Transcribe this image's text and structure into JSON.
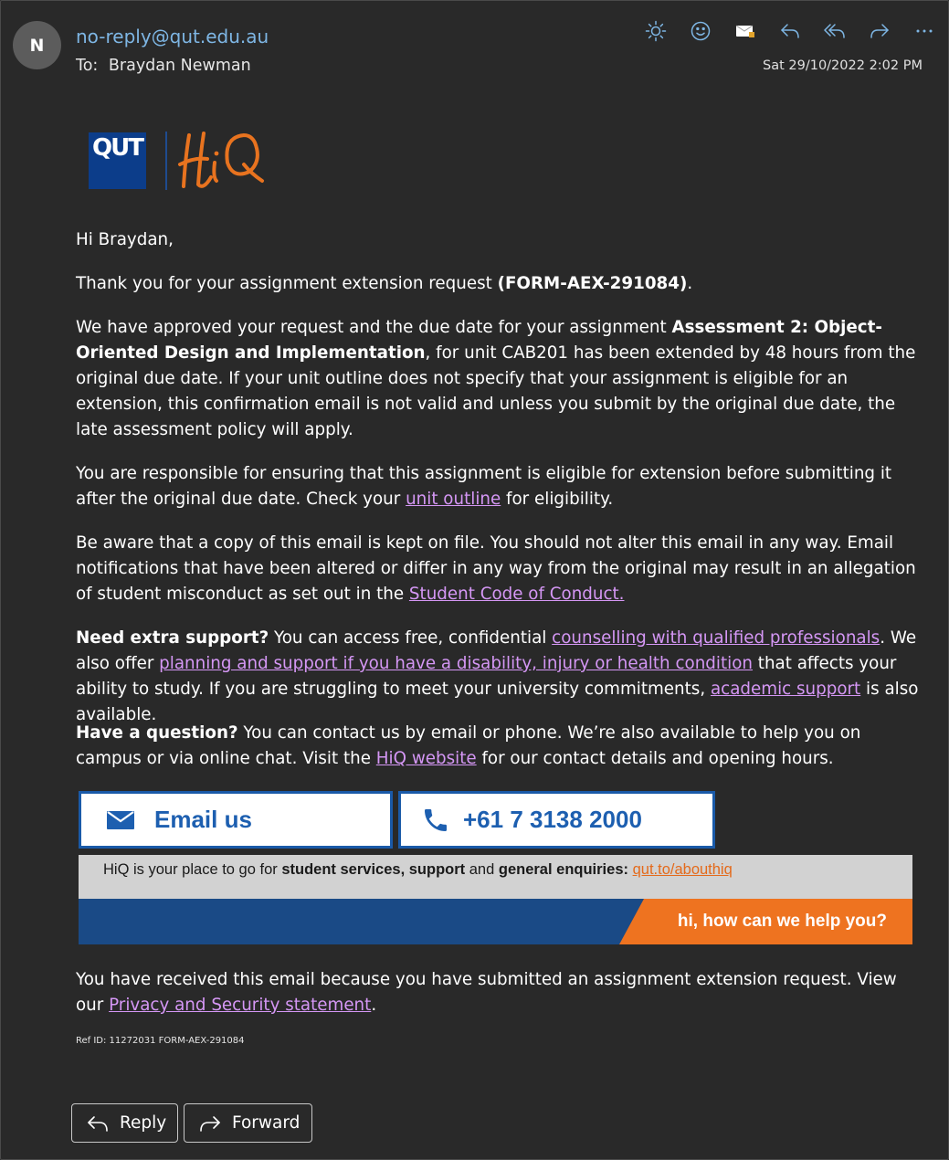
{
  "header": {
    "avatar_initial": "N",
    "sender": "no-reply@qut.edu.au",
    "to_label": "To:",
    "to_name": "Braydan Newman",
    "timestamp": "Sat 29/10/2022 2:02 PM",
    "toolbar_icons": [
      "sun-icon",
      "emoji-icon",
      "envelope-icon",
      "reply-icon",
      "reply-all-icon",
      "forward-icon",
      "more-icon"
    ]
  },
  "logo": {
    "qut": "QUT",
    "hiq": "HiQ"
  },
  "greeting": "Hi Braydan,",
  "p1": {
    "t1": "Thank you for your assignment extension request ",
    "b1": "(FORM-AEX-291084)",
    "t2": "."
  },
  "p2": {
    "t1": "We have approved your request and the due date for your assignment ",
    "b1": "Assessment 2: Object-Oriented Design and Implementation",
    "t2": ", for unit CAB201 has been extended by 48 hours from the original due date. If your unit outline does not specify that your assignment is eligible for an extension, this confirmation email is not valid and unless you submit by the original due date, the late assessment policy will apply."
  },
  "p3": {
    "t1": "You are responsible for ensuring that this assignment is eligible for extension before submitting it after the original due date. Check your ",
    "link1": "unit outline",
    "t2": " for eligibility."
  },
  "p4": {
    "t1": "Be aware that a copy of this email is kept on file. You should not alter this email in any way. Email notifications that have been altered or differ in any way from the original may result in an allegation of student misconduct as set out in the ",
    "link1": "Student Code of Conduct."
  },
  "p5": {
    "b1": "Need extra support?",
    "t1": " You can access free, confidential ",
    "link1": "counselling with qualified professionals",
    "t2": ". We also offer ",
    "link2": "planning and support if you have a disability, injury or health condition",
    "t3": " that affects your ability to study. If you are struggling to meet your university commitments, ",
    "link3": "academic support",
    "t4": " is also available."
  },
  "p6": {
    "b1": "Have a question?",
    "t1": " You can contact us by email or phone. We’re also available to help you on campus or via online chat. Visit the ",
    "link1": "HiQ website",
    "t2": " for our contact details and opening hours."
  },
  "contact": {
    "email_label": "Email us",
    "phone_label": "+61 7 3138 2000"
  },
  "banner": {
    "t1": "HiQ is your place to go for ",
    "b1": "student services, support",
    "t2": " and ",
    "b2": "general enquiries:",
    "t3": " ",
    "link": "qut.to/abouthiq",
    "tagline": "hi, how can we help you?"
  },
  "footer": {
    "t1": "You have received this email because you have submitted an assignment extension request. View our ",
    "link1": "Privacy and Security statement",
    "t2": "."
  },
  "ref": "Ref ID: 11272031 FORM-AEX-291084",
  "actions": {
    "reply": "Reply",
    "forward": "Forward"
  },
  "colors": {
    "background": "#292929",
    "link": "#d597f5",
    "sender": "#7eb6e4",
    "qut_blue": "#1a4a86",
    "hiq_orange": "#ee7320"
  }
}
